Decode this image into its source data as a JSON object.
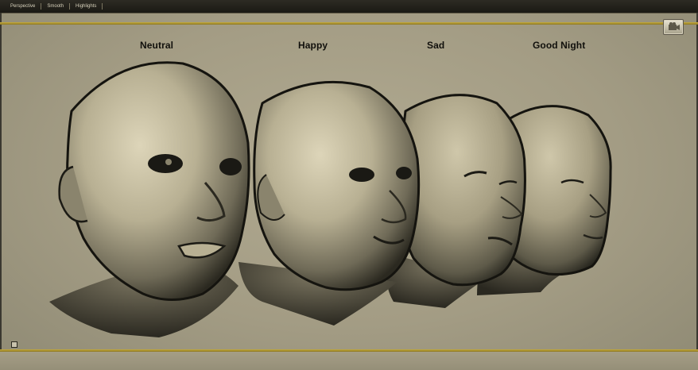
{
  "menu": {
    "items": [
      "Perspective",
      "Smooth",
      "Highlights"
    ]
  },
  "labels": {
    "neutral": "Neutral",
    "happy": "Happy",
    "sad": "Sad",
    "good_night": "Good Night"
  },
  "colors": {
    "background": "#a39c84",
    "accent_line": "#c7ad3f",
    "topbar": "#1a1914"
  },
  "icons": {
    "camera": "camera-icon",
    "corner": "axis-icon"
  }
}
